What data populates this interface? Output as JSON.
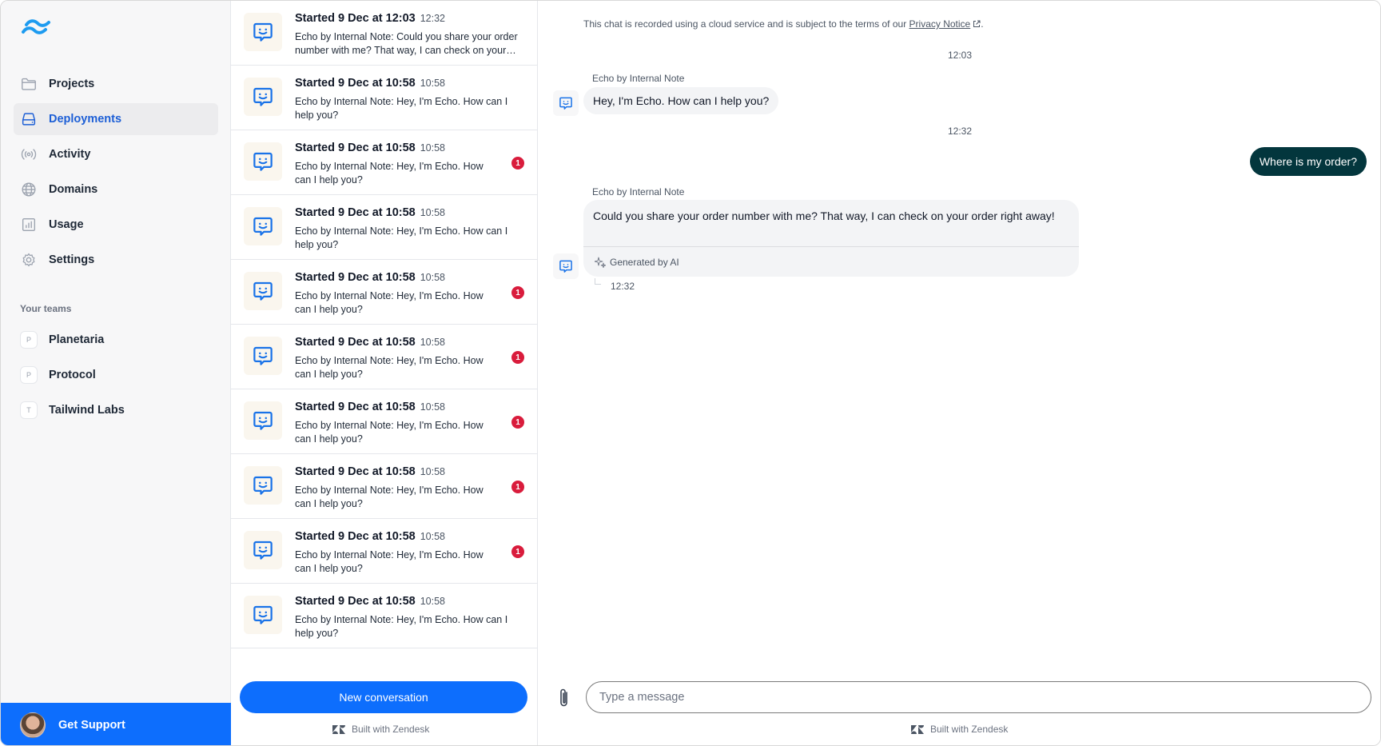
{
  "sidebar": {
    "nav": [
      {
        "label": "Projects",
        "icon": "folder-icon"
      },
      {
        "label": "Deployments",
        "icon": "server-icon",
        "active": true
      },
      {
        "label": "Activity",
        "icon": "signal-icon"
      },
      {
        "label": "Domains",
        "icon": "globe-icon"
      },
      {
        "label": "Usage",
        "icon": "chart-icon"
      },
      {
        "label": "Settings",
        "icon": "gear-icon"
      }
    ],
    "teams_title": "Your teams",
    "teams": [
      {
        "initial": "P",
        "label": "Planetaria"
      },
      {
        "initial": "P",
        "label": "Protocol"
      },
      {
        "initial": "T",
        "label": "Tailwind Labs"
      }
    ],
    "support_label": "Get Support",
    "accent": "#0d6efd"
  },
  "conversations": [
    {
      "title": "Started 9 Dec at 12:03",
      "time": "12:32",
      "preview": "Echo by Internal Note: Could you share your order number with me? That way, I can check on your…",
      "unread": null
    },
    {
      "title": "Started 9 Dec at 10:58",
      "time": "10:58",
      "preview": "Echo by Internal Note: Hey, I'm Echo. How can I help you?",
      "unread": null
    },
    {
      "title": "Started 9 Dec at 10:58",
      "time": "10:58",
      "preview": "Echo by Internal Note: Hey, I'm Echo. How can I help you?",
      "unread": "1"
    },
    {
      "title": "Started 9 Dec at 10:58",
      "time": "10:58",
      "preview": "Echo by Internal Note: Hey, I'm Echo. How can I help you?",
      "unread": null
    },
    {
      "title": "Started 9 Dec at 10:58",
      "time": "10:58",
      "preview": "Echo by Internal Note: Hey, I'm Echo. How can I help you?",
      "unread": "1"
    },
    {
      "title": "Started 9 Dec at 10:58",
      "time": "10:58",
      "preview": "Echo by Internal Note: Hey, I'm Echo. How can I help you?",
      "unread": "1"
    },
    {
      "title": "Started 9 Dec at 10:58",
      "time": "10:58",
      "preview": "Echo by Internal Note: Hey, I'm Echo. How can I help you?",
      "unread": "1"
    },
    {
      "title": "Started 9 Dec at 10:58",
      "time": "10:58",
      "preview": "Echo by Internal Note: Hey, I'm Echo. How can I help you?",
      "unread": "1"
    },
    {
      "title": "Started 9 Dec at 10:58",
      "time": "10:58",
      "preview": "Echo by Internal Note: Hey, I'm Echo. How can I help you?",
      "unread": "1"
    },
    {
      "title": "Started 9 Dec at 10:58",
      "time": "10:58",
      "preview": "Echo by Internal Note: Hey, I'm Echo. How can I help you?",
      "unread": null
    }
  ],
  "list_footer": {
    "new_conversation": "New conversation",
    "built_with": "Built with Zendesk"
  },
  "chat": {
    "notice_text": "This chat is recorded using a cloud service and is subject to the terms of our ",
    "notice_link": "Privacy Notice",
    "notice_end": ".",
    "stamp1": "12:03",
    "sender1": "Echo by Internal Note",
    "msg1": "Hey, I'm Echo. How can I help you?",
    "stamp2": "12:32",
    "user_msg": "Where is my order?",
    "sender2": "Echo by Internal Note",
    "msg2": "Could you share your order number with me? That way, I can check on your order right away!",
    "generated_label": "Generated by AI",
    "msg2_time": "12:32",
    "composer_placeholder": "Type a message",
    "built_with": "Built with Zendesk",
    "user_bubble_color": "#03363d"
  }
}
